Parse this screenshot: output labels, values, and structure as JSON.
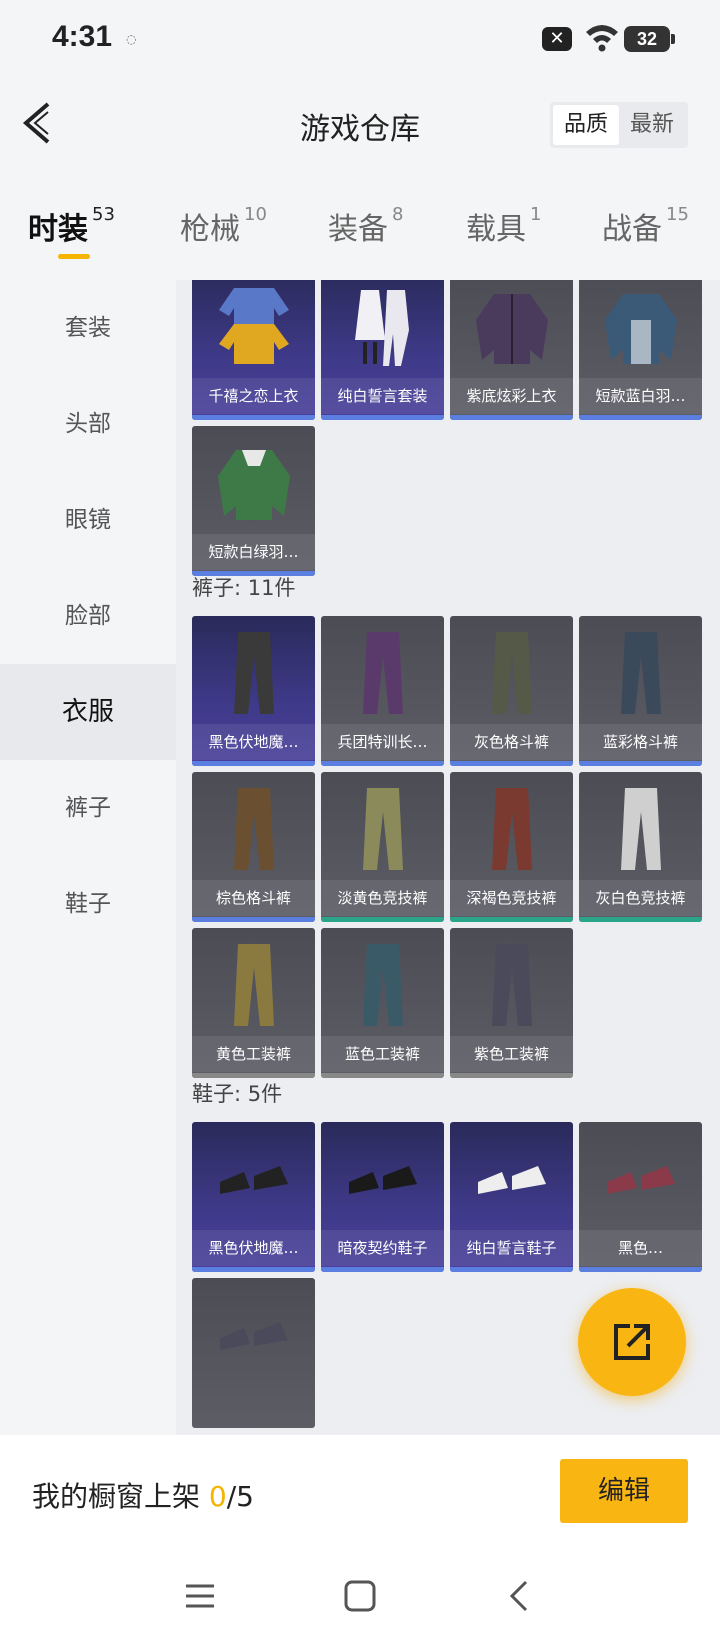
{
  "status": {
    "time": "4:31",
    "small_icon": "◌",
    "battery": "32"
  },
  "header": {
    "title": "游戏仓库",
    "sort": [
      "品质",
      "最新"
    ]
  },
  "tabs": [
    {
      "label": "时装",
      "count": "53"
    },
    {
      "label": "枪械",
      "count": "10"
    },
    {
      "label": "装备",
      "count": "8"
    },
    {
      "label": "载具",
      "count": "1"
    },
    {
      "label": "战备",
      "count": "15"
    }
  ],
  "sidebar": [
    "套装",
    "头部",
    "眼镜",
    "脸部",
    "衣服",
    "裤子",
    "鞋子"
  ],
  "clothes": [
    {
      "name": "千禧之恋上衣",
      "icon": "sweater-icon"
    },
    {
      "name": "纯白誓言套装",
      "icon": "outfit-icon"
    },
    {
      "name": "紫底炫彩上衣",
      "icon": "jacket-icon"
    },
    {
      "name": "短款蓝白羽…",
      "icon": "jacket-icon"
    },
    {
      "name": "短款白绿羽…",
      "icon": "jacket-icon"
    }
  ],
  "pants_title": "裤子: 11件",
  "pants": [
    {
      "name": "黑色伏地魔…"
    },
    {
      "name": "兵团特训长…"
    },
    {
      "name": "灰色格斗裤"
    },
    {
      "name": "蓝彩格斗裤"
    },
    {
      "name": "棕色格斗裤"
    },
    {
      "name": "淡黄色竞技裤"
    },
    {
      "name": "深褐色竞技裤"
    },
    {
      "name": "灰白色竞技裤"
    },
    {
      "name": "黄色工装裤"
    },
    {
      "name": "蓝色工装裤"
    },
    {
      "name": "紫色工装裤"
    }
  ],
  "shoes_title": "鞋子: 5件",
  "shoes": [
    {
      "name": "黑色伏地魔…"
    },
    {
      "name": "暗夜契约鞋子"
    },
    {
      "name": "纯白誓言鞋子"
    },
    {
      "name": "黑色…"
    },
    {
      "name": ""
    }
  ],
  "bottom": {
    "showcase_label": "我的橱窗上架 ",
    "showcase_count": "0",
    "showcase_total": "/5",
    "edit": "编辑"
  },
  "colors": {
    "accent": "#f9b613",
    "blue_bar": "#5b7fe0",
    "green_bar": "#2aa58a",
    "purple_bar": "#6a5ad0"
  }
}
